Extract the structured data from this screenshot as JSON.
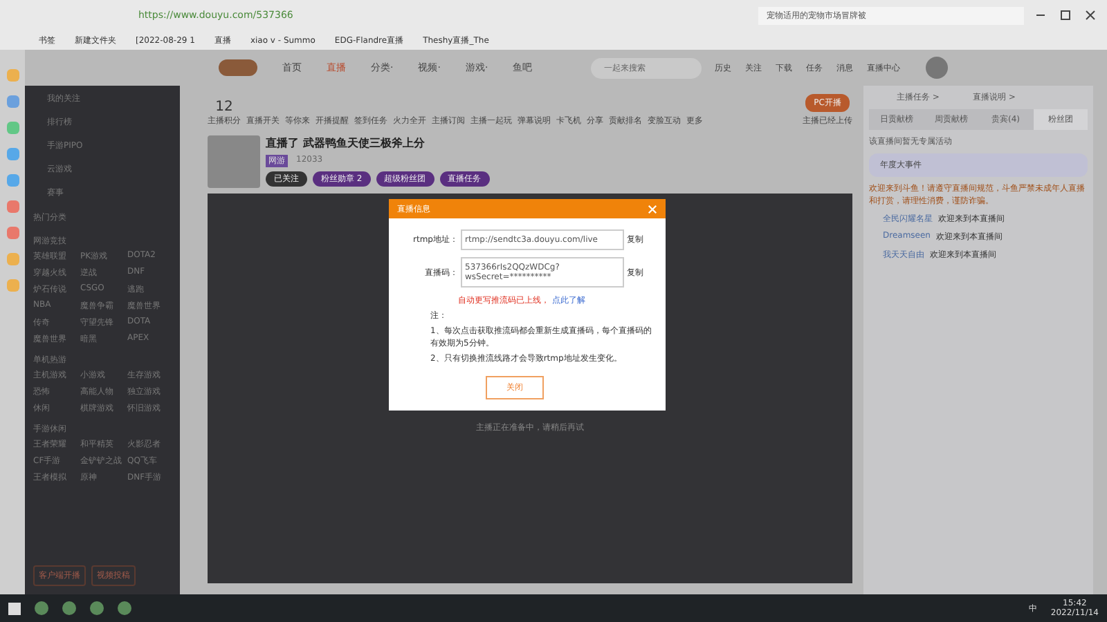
{
  "browser": {
    "url": "https://www.douyu.com/537366",
    "search": "宠物适用的宠物市场冒牌被",
    "bookmarks": [
      "书签",
      "新建文件夹",
      "[2022-08-29 1",
      "直播",
      "xiao v - Summo",
      "EDG-Flandre直播",
      "Theshy直播_The"
    ]
  },
  "nav": {
    "items": [
      {
        "label": "首页",
        "selected": false
      },
      {
        "label": "直播",
        "selected": true
      },
      {
        "label": "分类·",
        "selected": false
      },
      {
        "label": "视频·",
        "selected": false
      },
      {
        "label": "游戏·",
        "selected": false
      },
      {
        "label": "鱼吧",
        "selected": false
      }
    ],
    "search_placeholder": "一起来搜索",
    "icons": [
      "历史",
      "关注",
      "下载",
      "任务",
      "消息",
      "直播中心"
    ]
  },
  "sidebar": {
    "items": [
      "我的关注",
      "排行榜",
      "手游PIPO",
      "云游戏",
      "赛事"
    ],
    "sections": [
      {
        "title": "热门分类"
      },
      {
        "title": "网游竞技",
        "items": [
          "英雄联盟",
          "PK游戏",
          "DOTA2",
          "穿越火线",
          "逆战",
          "DNF",
          "炉石传说",
          "CSGO",
          "逃跑",
          "NBA",
          "魔兽争霸",
          "魔兽世界",
          "传奇",
          "守望先锋",
          "DOTA",
          "魔兽世界",
          "暗黑",
          "APEX"
        ]
      },
      {
        "title": "单机热游",
        "items": [
          "主机游戏",
          "小游戏",
          "生存游戏",
          "恐怖",
          "高能人物",
          "独立游戏",
          "休闲",
          "棋牌游戏",
          "怀旧游戏"
        ]
      },
      {
        "title": "手游休闲",
        "items": [
          "王者荣耀",
          "和平精英",
          "火影忍者",
          "CF手游",
          "金铲铲之战",
          "QQ飞车",
          "王者模拟",
          "原神",
          "DNF手游"
        ]
      }
    ],
    "buttons": [
      "客户端开播",
      "视频投稿"
    ]
  },
  "room": {
    "level": "12",
    "level_label": "主播积分",
    "title": "直播了 武器鸭鱼天使三极斧上分",
    "category": "网游",
    "meta": "12033",
    "tools": [
      "直播开关",
      "等你来",
      "开播提醒",
      "签到任务",
      "火力全开",
      "主播订阅",
      "主播一起玩",
      "弹幕说明",
      "卡飞机",
      "分享",
      "贡献排名",
      "变脸互动",
      "更多"
    ],
    "badges": [
      "已关注",
      "粉丝勋章 2",
      "超级粉丝团",
      "直播任务"
    ],
    "start_button": "PC开播",
    "start_note": "主播已经上传",
    "status": "主播正在准备中，请稍后再试"
  },
  "dialog": {
    "title": "直播信息",
    "rows": [
      {
        "label": "rtmp地址：",
        "value": "rtmp://sendtc3a.douyu.com/live",
        "action": "复制"
      },
      {
        "label": "直播码：",
        "value": "537366rIs2QQzWDCg?wsSecret=**********",
        "action": "复制"
      }
    ],
    "warning": "自动更写推流码已上线，",
    "link": "点此了解",
    "notes": [
      "注：",
      "1、每次点击获取推流码都会重新生成直播码，每个直播码的有效期为5分钟。",
      "2、只有切换推流线路才会导致rtmp地址发生变化。"
    ],
    "close_button": "关闭"
  },
  "chat": {
    "links": [
      "主播任务 >",
      "直播说明 >"
    ],
    "tabs": [
      {
        "label": "日贡献榜",
        "selected": false
      },
      {
        "label": "周贡献榜",
        "selected": false
      },
      {
        "label": "贵宾(4)",
        "selected": false
      },
      {
        "label": "粉丝团",
        "selected": true
      }
    ],
    "notice": "该直播间暂无专属活动",
    "event": "年度大事件",
    "system": "欢迎来到斗鱼！请遵守直播间规范，斗鱼严禁未成年人直播和打赏，请理性消费，谨防诈骗。",
    "messages": [
      {
        "user": "全民闪耀名星",
        "text": "欢迎来到本直播间"
      },
      {
        "user": "Dreamseen",
        "text": "欢迎来到本直播间"
      },
      {
        "user": "我天天自由",
        "text": "欢迎来到本直播间"
      }
    ]
  },
  "taskbar": {
    "ime": "中",
    "time": "15:42",
    "date": "2022/11/14"
  }
}
